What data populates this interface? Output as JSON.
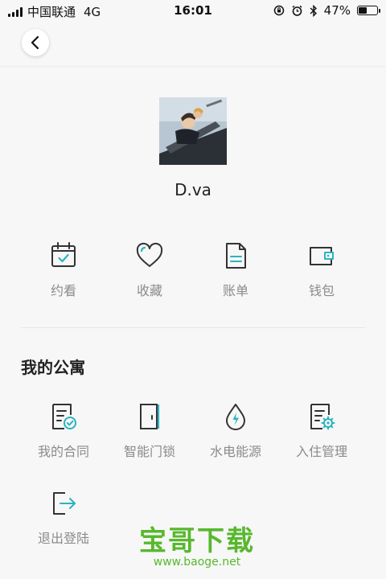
{
  "status_bar": {
    "carrier": "中国联通",
    "network": "4G",
    "time": "16:01",
    "battery_text": "47%",
    "battery_level": 0.47
  },
  "nav": {
    "back_icon": "chevron-left-icon"
  },
  "profile": {
    "username": "D.va"
  },
  "quick_actions": [
    {
      "label": "约看",
      "icon": "calendar-check-icon"
    },
    {
      "label": "收藏",
      "icon": "heart-icon"
    },
    {
      "label": "账单",
      "icon": "document-icon"
    },
    {
      "label": "钱包",
      "icon": "wallet-icon"
    }
  ],
  "apartment": {
    "title": "我的公寓",
    "items": [
      {
        "label": "我的合同",
        "icon": "contract-icon"
      },
      {
        "label": "智能门锁",
        "icon": "door-icon"
      },
      {
        "label": "水电能源",
        "icon": "water-energy-icon"
      },
      {
        "label": "入住管理",
        "icon": "checkin-settings-icon"
      },
      {
        "label": "退出登陆",
        "icon": "logout-icon"
      }
    ]
  },
  "watermark": {
    "main": "宝哥下载",
    "url": "www.baoge.net"
  },
  "colors": {
    "accent": "#2bb3c0",
    "icon_stroke": "#333333",
    "label": "#8b8b8b",
    "watermark": "#58b82d"
  }
}
